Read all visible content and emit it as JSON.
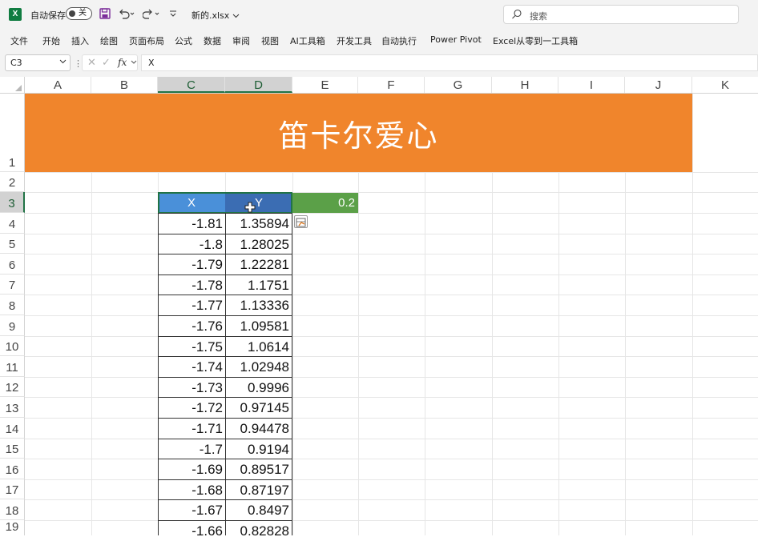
{
  "titlebar": {
    "app_icon": "excel-logo-icon",
    "app_icon_letter": "X",
    "autosave_label": "自动保存",
    "autosave_toggle": "关",
    "filename": "新的.xlsx",
    "search_placeholder": "搜索"
  },
  "menu": {
    "items": [
      "文件",
      "开始",
      "插入",
      "绘图",
      "页面布局",
      "公式",
      "数据",
      "审阅",
      "视图",
      "AI工具箱",
      "开发工具",
      "自动执行",
      "Power Pivot",
      "Excel从零到一工具箱"
    ]
  },
  "formula_bar": {
    "name_box": "C3",
    "fx": "fx",
    "content": "X"
  },
  "columns": [
    "A",
    "B",
    "C",
    "D",
    "E",
    "F",
    "G",
    "H",
    "I",
    "J",
    "K"
  ],
  "rows": [
    "1",
    "2",
    "3",
    "4",
    "5",
    "6",
    "7",
    "8",
    "9",
    "10",
    "11",
    "12",
    "13",
    "14",
    "15",
    "16",
    "17",
    "18",
    "19"
  ],
  "sheet": {
    "banner_title": "笛卡尔爱心",
    "header_x": "X",
    "header_y": "Y",
    "parameter": "0.2",
    "x_values": [
      "-1.81",
      "-1.8",
      "-1.79",
      "-1.78",
      "-1.77",
      "-1.76",
      "-1.75",
      "-1.74",
      "-1.73",
      "-1.72",
      "-1.71",
      "-1.7",
      "-1.69",
      "-1.68",
      "-1.67",
      "-1.66"
    ],
    "y_values": [
      "1.35894",
      "1.28025",
      "1.22281",
      "1.1751",
      "1.13336",
      "1.09581",
      "1.0614",
      "1.02948",
      "0.9996",
      "0.97145",
      "0.94478",
      "0.9194",
      "0.89517",
      "0.87197",
      "0.8497",
      "0.82828"
    ]
  },
  "colors": {
    "banner": "#f0852c",
    "header_x": "#4a90d9",
    "header_y": "#3b6db3",
    "parameter_cell": "#5ba048",
    "selection": "#217346"
  }
}
